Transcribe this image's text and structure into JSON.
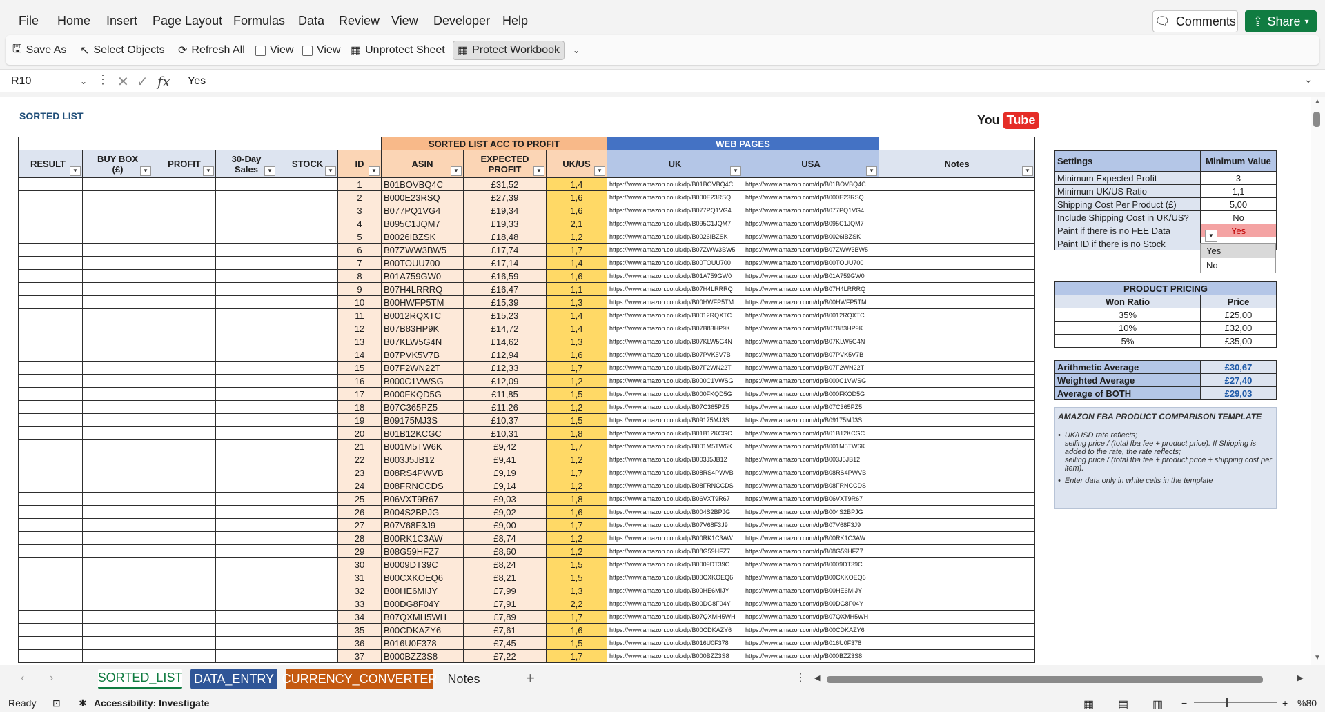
{
  "menu": [
    "File",
    "Home",
    "Insert",
    "Page Layout",
    "Formulas",
    "Data",
    "Review",
    "View",
    "Developer",
    "Help"
  ],
  "comments_label": "Comments",
  "share_label": "Share",
  "ribbon": {
    "save_as": "Save As",
    "select_objects": "Select Objects",
    "refresh_all": "Refresh All",
    "view1": "View",
    "view2": "View",
    "unprotect_sheet": "Unprotect Sheet",
    "protect_workbook": "Protect Workbook"
  },
  "formula_bar": {
    "name_box": "R10",
    "fx": "fx",
    "value": "Yes"
  },
  "sheet": {
    "title": "SORTED LIST",
    "youtube_you": "You",
    "youtube_tube": "Tube",
    "group_sorted": "SORTED LIST ACC TO PROFIT",
    "group_web": "WEB PAGES",
    "headers": {
      "result": "RESULT",
      "buy_box_1": "BUY BOX",
      "buy_box_2": "(£)",
      "profit": "PROFIT",
      "sales_1": "30-Day",
      "sales_2": "Sales",
      "stock": "STOCK",
      "id": "ID",
      "asin": "ASIN",
      "expected_1": "EXPECTED",
      "expected_2": "PROFIT",
      "ukus": "UK/US",
      "uk": "UK",
      "usa": "USA",
      "notes": "Notes"
    },
    "rows": [
      [
        "1",
        "B01BOVBQ4C",
        "£31,52",
        "1,4"
      ],
      [
        "2",
        "B000E23RSQ",
        "£27,39",
        "1,6"
      ],
      [
        "3",
        "B077PQ1VG4",
        "£19,34",
        "1,6"
      ],
      [
        "4",
        "B095C1JQM7",
        "£19,33",
        "2,1"
      ],
      [
        "5",
        "B0026IBZSK",
        "£18,48",
        "1,2"
      ],
      [
        "6",
        "B07ZWW3BW5",
        "£17,74",
        "1,7"
      ],
      [
        "7",
        "B00TOUU700",
        "£17,14",
        "1,4"
      ],
      [
        "8",
        "B01A759GW0",
        "£16,59",
        "1,6"
      ],
      [
        "9",
        "B07H4LRRRQ",
        "£16,47",
        "1,1"
      ],
      [
        "10",
        "B00HWFP5TM",
        "£15,39",
        "1,3"
      ],
      [
        "11",
        "B0012RQXTC",
        "£15,23",
        "1,4"
      ],
      [
        "12",
        "B07B83HP9K",
        "£14,72",
        "1,4"
      ],
      [
        "13",
        "B07KLW5G4N",
        "£14,62",
        "1,3"
      ],
      [
        "14",
        "B07PVK5V7B",
        "£12,94",
        "1,6"
      ],
      [
        "15",
        "B07F2WN22T",
        "£12,33",
        "1,7"
      ],
      [
        "16",
        "B000C1VWSG",
        "£12,09",
        "1,2"
      ],
      [
        "17",
        "B000FKQD5G",
        "£11,85",
        "1,5"
      ],
      [
        "18",
        "B07C365PZ5",
        "£11,26",
        "1,2"
      ],
      [
        "19",
        "B09175MJ3S",
        "£10,37",
        "1,5"
      ],
      [
        "20",
        "B01B12KCGC",
        "£10,31",
        "1,8"
      ],
      [
        "21",
        "B001M5TW6K",
        "£9,42",
        "1,7"
      ],
      [
        "22",
        "B003J5JB12",
        "£9,41",
        "1,2"
      ],
      [
        "23",
        "B08RS4PWVB",
        "£9,19",
        "1,7"
      ],
      [
        "24",
        "B08FRNCCDS",
        "£9,14",
        "1,2"
      ],
      [
        "25",
        "B06VXT9R67",
        "£9,03",
        "1,8"
      ],
      [
        "26",
        "B004S2BPJG",
        "£9,02",
        "1,6"
      ],
      [
        "27",
        "B07V68F3J9",
        "£9,00",
        "1,7"
      ],
      [
        "28",
        "B00RK1C3AW",
        "£8,74",
        "1,2"
      ],
      [
        "29",
        "B08G59HFZ7",
        "£8,60",
        "1,2"
      ],
      [
        "30",
        "B0009DT39C",
        "£8,24",
        "1,5"
      ],
      [
        "31",
        "B00CXKOEQ6",
        "£8,21",
        "1,5"
      ],
      [
        "32",
        "B00HE6MIJY",
        "£7,99",
        "1,3"
      ],
      [
        "33",
        "B00DG8F04Y",
        "£7,91",
        "2,2"
      ],
      [
        "34",
        "B07QXMH5WH",
        "£7,89",
        "1,7"
      ],
      [
        "35",
        "B00CDKAZY6",
        "£7,61",
        "1,6"
      ],
      [
        "36",
        "B016U0F378",
        "£7,45",
        "1,5"
      ],
      [
        "37",
        "B000BZZ3S8",
        "£7,22",
        "1,7"
      ]
    ],
    "url_uk_prefix": "https://www.amazon.co.uk/dp/",
    "url_us_prefix": "https://www.amazon.com/dp/"
  },
  "settings": {
    "header_label": "Settings",
    "header_value": "Minimum Value",
    "rows": [
      [
        "Minimum Expected Profit",
        "3"
      ],
      [
        "Minimum UK/US Ratio",
        "1,1"
      ],
      [
        "Shipping Cost Per Product (£)",
        "5,00"
      ],
      [
        "Include Shipping Cost in UK/US?",
        "No"
      ],
      [
        "Paint if there is no FEE Data",
        "Yes"
      ],
      [
        "Paint ID if there is no Stock",
        ""
      ]
    ],
    "dropdown": [
      "Yes",
      "No"
    ]
  },
  "pricing": {
    "title": "PRODUCT PRICING",
    "col1": "Won Ratio",
    "col2": "Price",
    "rows": [
      [
        "35%",
        "£25,00"
      ],
      [
        "10%",
        "£32,00"
      ],
      [
        "5%",
        "£35,00"
      ]
    ]
  },
  "averages": [
    [
      "Arithmetic Average",
      "£30,67"
    ],
    [
      "Weighted Average",
      "£27,40"
    ],
    [
      "Average of BOTH",
      "£29,03"
    ]
  ],
  "note": {
    "title": "AMAZON FBA PRODUCT COMPARISON TEMPLATE",
    "bullet1_line1": "UK/USD rate reflects;",
    "bullet1_line2": "selling price / (total fba fee + product price). If Shipping is added to the rate, the rate reflects;",
    "bullet1_line3": "selling price / (total fba fee + product price + shipping cost per item).",
    "bullet2": "Enter data only in white cells in the template"
  },
  "tabs": [
    "SORTED_LIST",
    "DATA_ENTRY",
    "CURRENCY_CONVERTER",
    "Notes"
  ],
  "status": {
    "ready": "Ready",
    "accessibility": "Accessibility: Investigate",
    "zoom": "%80"
  }
}
